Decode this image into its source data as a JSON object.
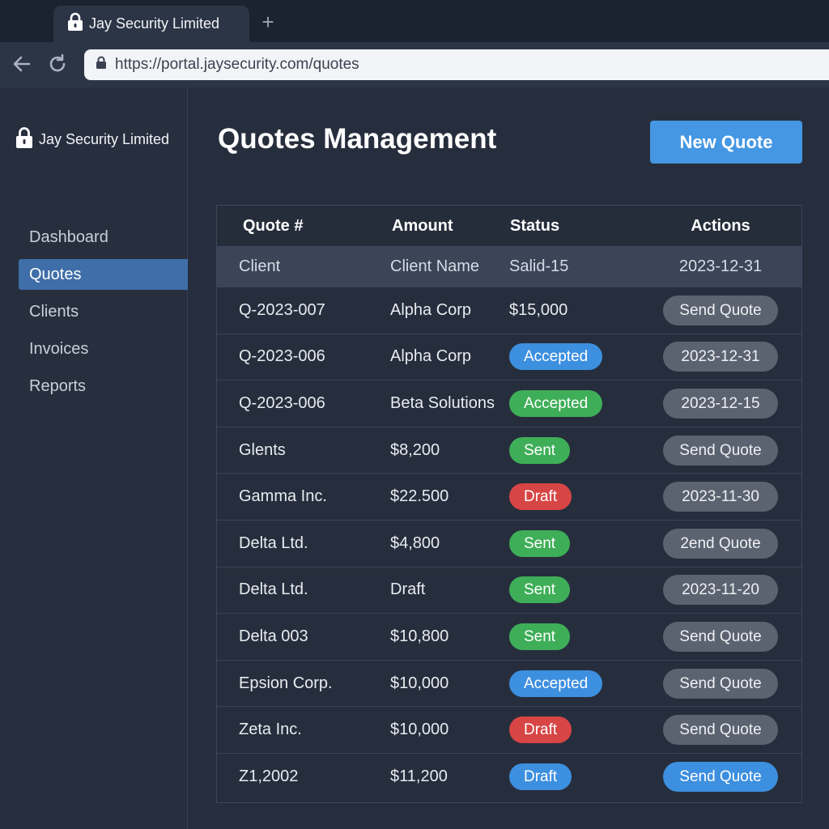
{
  "browser": {
    "tab_title": "Jay Security Limited",
    "new_tab_label": "+",
    "url": "https://portal.jaysecurity.com/quotes"
  },
  "sidebar": {
    "brand": "Jay Security Limited",
    "items": [
      {
        "label": "Dashboard",
        "active": false
      },
      {
        "label": "Quotes",
        "active": true
      },
      {
        "label": "Clients",
        "active": false
      },
      {
        "label": "Invoices",
        "active": false
      },
      {
        "label": "Reports",
        "active": false
      }
    ]
  },
  "main": {
    "title": "Quotes Management",
    "new_quote_label": "New Quote"
  },
  "table": {
    "headers": [
      "Quote #",
      "Amount",
      "Status",
      "Actions"
    ],
    "subheader": [
      "Client",
      "Client Name",
      "Salid-15",
      "2023-12-31"
    ],
    "rows": [
      {
        "c1": "Q-2023-007",
        "c2": "Alpha Corp",
        "c3": "$15,000",
        "status": null,
        "action": "Send Quote",
        "action_style": "gray"
      },
      {
        "c1": "Q-2023-006",
        "c2": "Alpha Corp",
        "c3": null,
        "status": "Accepted",
        "status_style": "accepted",
        "action": "2023-12-31",
        "action_style": "gray"
      },
      {
        "c1": "Q-2023-006",
        "c2": "Beta Solutions",
        "c3": null,
        "status": "Accepted",
        "status_style": "sent",
        "action": "2023-12-15",
        "action_style": "gray"
      },
      {
        "c1": "Glents",
        "c2": "$8,200",
        "c3": null,
        "status": "Sent",
        "status_style": "sent",
        "action": "Send Quote",
        "action_style": "gray"
      },
      {
        "c1": "Gamma Inc.",
        "c2": "$22.500",
        "c3": null,
        "status": "Draft",
        "status_style": "draft",
        "action": "2023-11-30",
        "action_style": "gray"
      },
      {
        "c1": "Delta Ltd.",
        "c2": "$4,800",
        "c3": null,
        "status": "Sent",
        "status_style": "sent",
        "action": "2end Quote",
        "action_style": "gray"
      },
      {
        "c1": "Delta Ltd.",
        "c2": "Draft",
        "c3": null,
        "status": "Sent",
        "status_style": "sent",
        "action": "2023-11-20",
        "action_style": "gray"
      },
      {
        "c1": "Delta 003",
        "c2": "$10,800",
        "c3": null,
        "status": "Sent",
        "status_style": "sent",
        "action": "Send Quote",
        "action_style": "gray"
      },
      {
        "c1": "Epsion Corp.",
        "c2": "$10,000",
        "c3": null,
        "status": "Accepted",
        "status_style": "accepted",
        "action": "Send Quote",
        "action_style": "gray"
      },
      {
        "c1": "Zeta Inc.",
        "c2": "$10,000",
        "c3": null,
        "status": "Draft",
        "status_style": "draft",
        "action": "Send Quote",
        "action_style": "gray"
      },
      {
        "c1": "Z1,2002",
        "c2": "$11,200",
        "c3": null,
        "status": "Draft",
        "status_style": "draft-blue",
        "action": "Send Quote",
        "action_style": "primary"
      }
    ]
  },
  "colors": {
    "accent": "#4597e3",
    "sidebar_active": "#3f6ea8",
    "status_accepted": "#3d8fdf",
    "status_sent": "#3fae58",
    "status_draft": "#d84545",
    "action_gray": "#5b6270"
  },
  "icons": {
    "tab": "lock-icon",
    "back": "back-arrow-icon",
    "reload": "reload-icon",
    "address": "lock-icon",
    "brand": "lock-icon"
  }
}
